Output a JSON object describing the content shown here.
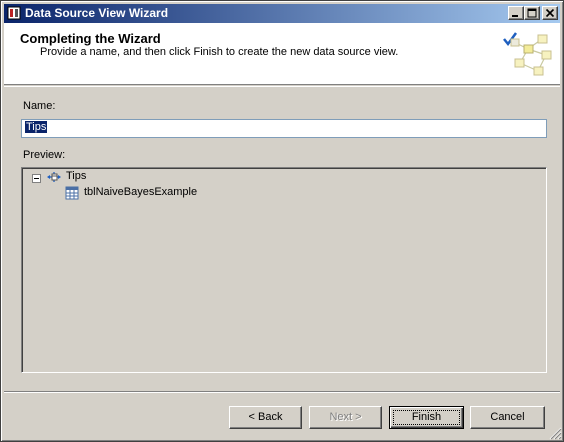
{
  "window": {
    "title": "Data Source View Wizard"
  },
  "header": {
    "title": "Completing the Wizard",
    "subtitle": "Provide a name, and then click Finish to create the new data source view."
  },
  "name_field": {
    "label": "Name:",
    "value": "Tips"
  },
  "preview": {
    "label": "Preview:",
    "tree": [
      {
        "label": "Tips",
        "icon": "data-source-view-icon",
        "expanded": true
      },
      {
        "label": "tblNaiveBayesExample",
        "icon": "table-icon"
      }
    ]
  },
  "buttons": {
    "back": "< Back",
    "next": "Next >",
    "finish": "Finish",
    "cancel": "Cancel"
  },
  "colors": {
    "titlebar_start": "#0a246a",
    "titlebar_end": "#a6caf0",
    "dialog_bg": "#d4d0c8",
    "selection": "#0a246a"
  }
}
